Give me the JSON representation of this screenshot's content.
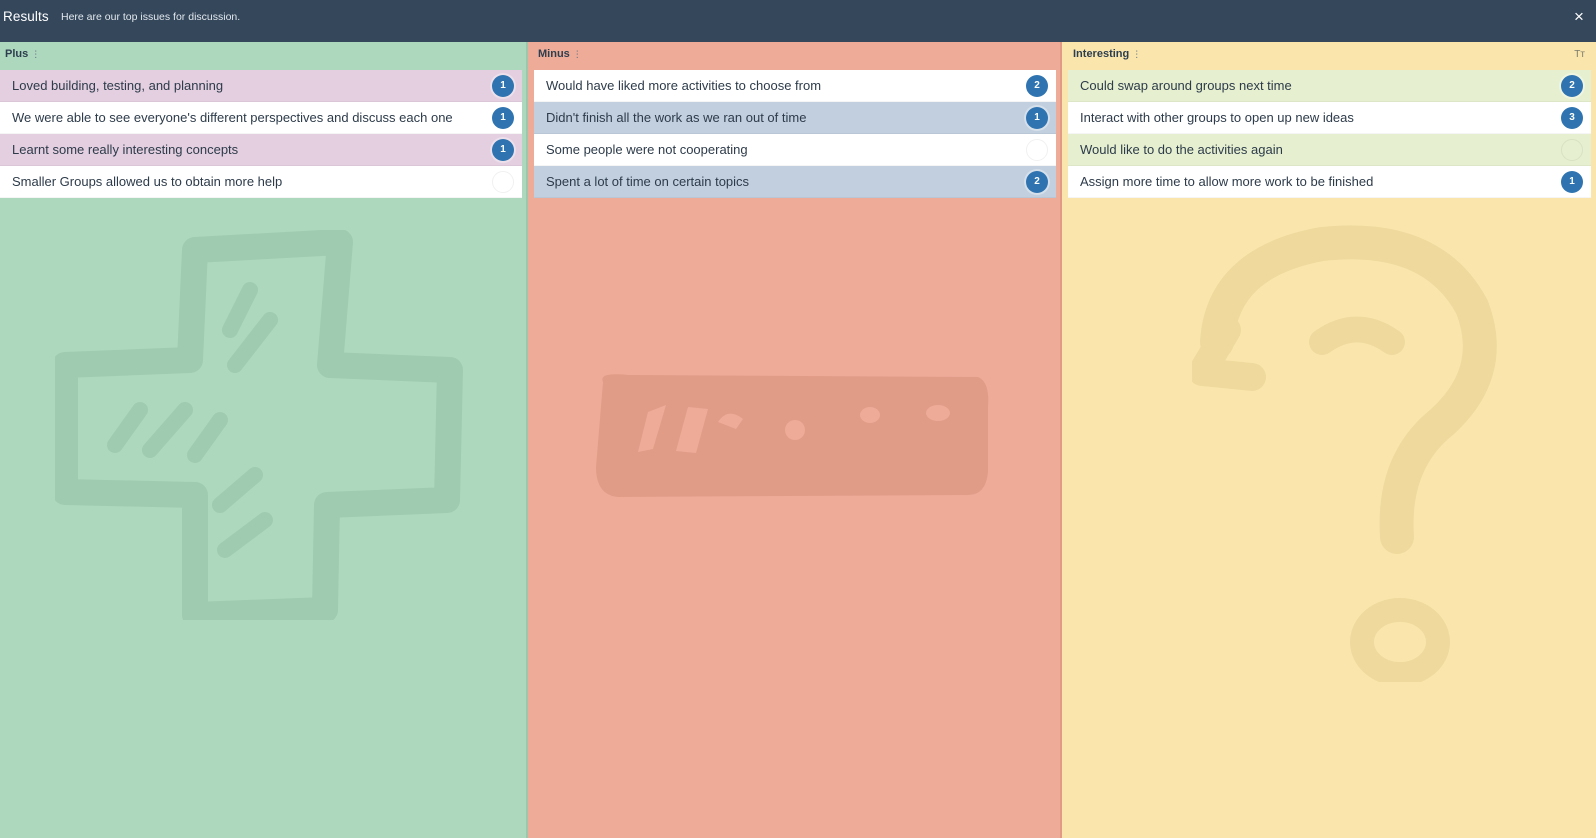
{
  "header": {
    "title": "Results",
    "subtitle": "Here are our top issues for discussion.",
    "close_icon": "×"
  },
  "columns": {
    "plus": {
      "title": "Plus",
      "background": "#aed8bd",
      "cards": [
        {
          "text": "Loved building, testing, and planning",
          "votes": "1",
          "color": "#e3cfe0"
        },
        {
          "text": "We were able to see everyone's different perspectives and discuss each one",
          "votes": "1",
          "color": "#ffffff"
        },
        {
          "text": "Learnt some really interesting concepts",
          "votes": "1",
          "color": "#e3cfe0"
        },
        {
          "text": "Smaller Groups allowed us to obtain more help",
          "votes": "",
          "color": "#ffffff"
        }
      ]
    },
    "minus": {
      "title": "Minus",
      "background": "#eeab98",
      "cards": [
        {
          "text": "Would have liked more activities to choose from",
          "votes": "2",
          "color": "#ffffff"
        },
        {
          "text": "Didn't finish all the work as we ran out of time",
          "votes": "1",
          "color": "#c1cfdf"
        },
        {
          "text": "Some people were not cooperating",
          "votes": "",
          "color": "#ffffff"
        },
        {
          "text": "Spent a lot of time on certain topics",
          "votes": "2",
          "color": "#c1cfdf"
        }
      ]
    },
    "interesting": {
      "title": "Interesting",
      "background": "#fae6ad",
      "text_size_icon": "Tт",
      "cards": [
        {
          "text": "Could swap around groups next time",
          "votes": "2",
          "color": "#e6f0d0"
        },
        {
          "text": "Interact with other groups to open up new ideas",
          "votes": "3",
          "color": "#ffffff"
        },
        {
          "text": "Would like to do the activities again",
          "votes": "",
          "color": "#e6f0d0"
        },
        {
          "text": "Assign more time to allow more work to be finished",
          "votes": "1",
          "color": "#ffffff"
        }
      ]
    }
  },
  "icons": {
    "close": "close-icon",
    "column_menu": "drag-handle-icon",
    "text_size": "text-size-icon",
    "plus_watermark": "plus-sign-icon",
    "minus_watermark": "minus-sign-icon",
    "question_watermark": "question-mark-icon"
  }
}
